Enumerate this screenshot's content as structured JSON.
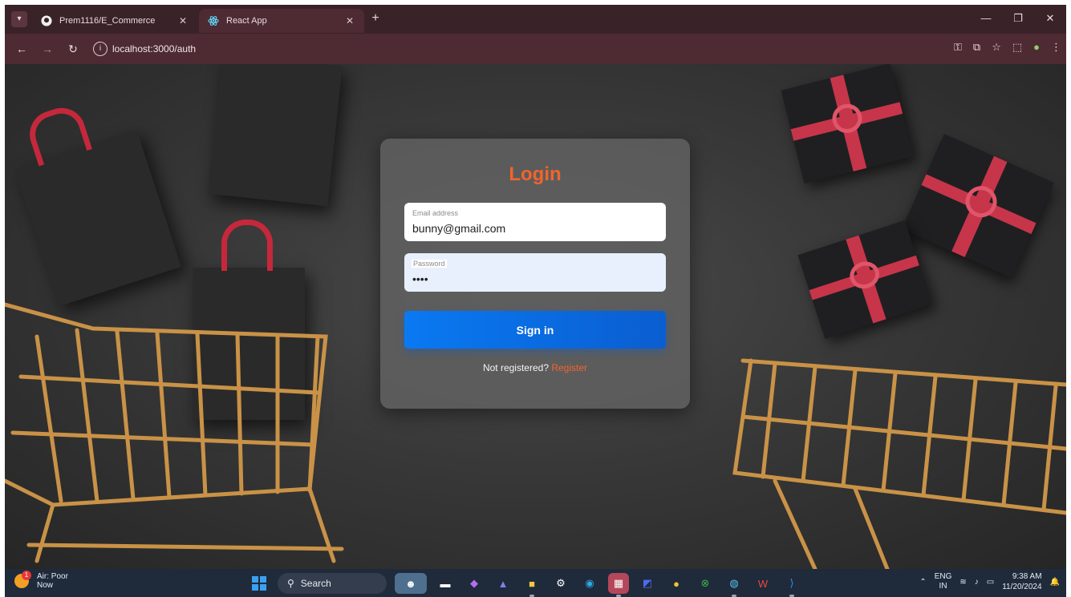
{
  "browser": {
    "tabs": [
      {
        "title": "Prem1116/E_Commerce",
        "icon": "github-icon",
        "active": false
      },
      {
        "title": "React App",
        "icon": "react-icon",
        "active": true
      }
    ],
    "address": "localhost:3000/auth"
  },
  "login": {
    "title": "Login",
    "email_label": "Email address",
    "email_value": "bunny@gmail.com",
    "password_label": "Password",
    "password_value": "••••",
    "signin_label": "Sign in",
    "register_prompt": "Not registered?",
    "register_link": "Register"
  },
  "taskbar": {
    "weather": {
      "line1": "Air: Poor",
      "line2": "Now",
      "badge": "1"
    },
    "search_label": "Search",
    "lang": {
      "top": "ENG",
      "bottom": "IN"
    },
    "time": "9:38 AM",
    "date": "11/20/2024"
  },
  "colors": {
    "accent": "#f2642b",
    "button": "#0a79f2",
    "titlebar": "#3a2229"
  }
}
